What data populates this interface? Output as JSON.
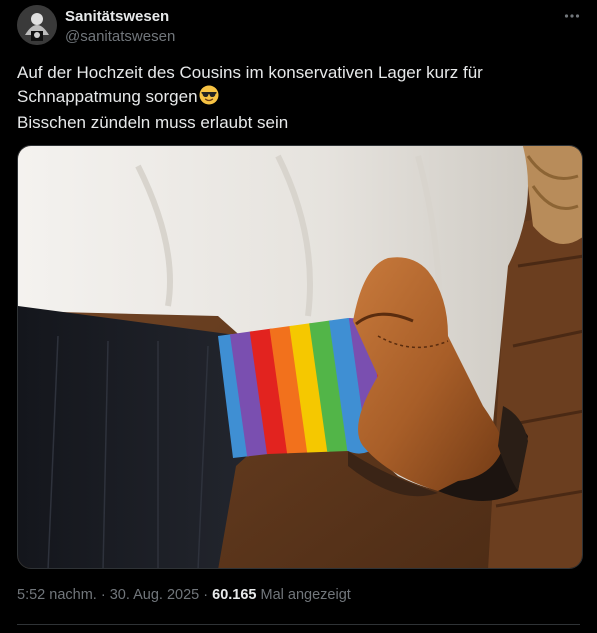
{
  "author": {
    "display_name": "Sanitätswesen",
    "handle": "@sanitatswesen",
    "avatar_icon": "avatar-icon"
  },
  "more_icon": "more-horizontal-icon",
  "tweet": {
    "line1": "Auf der Hochzeit des Cousins im konservativen Lager kurz für",
    "line2": "Schnappatmung sorgen",
    "line2_emoji": "smiling-face-with-sunglasses-emoji",
    "line3": "Bisschen zündeln muss erlaubt sein"
  },
  "media": {
    "description_icon": "photo-rainbow-sock-shoe"
  },
  "meta": {
    "time": "5:52 nachm.",
    "separator": "·",
    "date": "30. Aug. 2025",
    "views_count": "60.165",
    "views_label": "Mal angezeigt"
  },
  "colors": {
    "background": "#000000",
    "text_primary": "#e7e9ea",
    "text_secondary": "#71767b",
    "border": "#2f3336"
  }
}
